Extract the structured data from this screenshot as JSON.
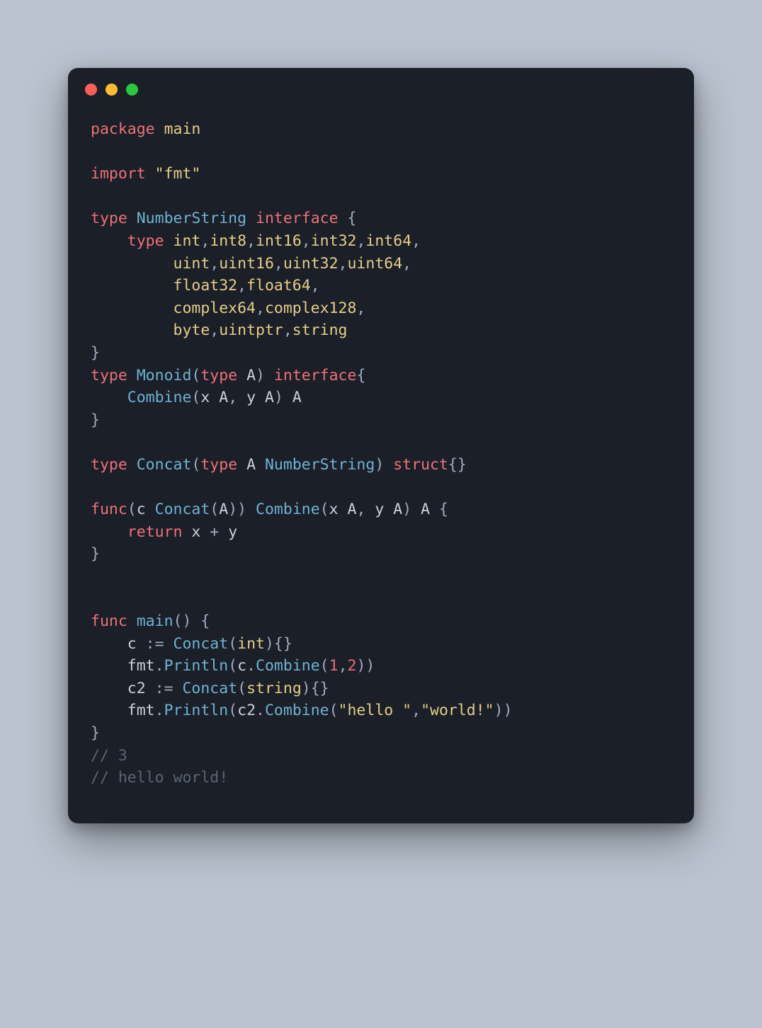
{
  "window": {
    "buttons": [
      "close",
      "minimize",
      "zoom"
    ]
  },
  "code": {
    "tokens": [
      [
        [
          "kw",
          "package"
        ],
        [
          "",
          ""
        ],
        [
          "",
          " "
        ],
        [
          "ident",
          "main"
        ]
      ],
      [],
      [
        [
          "kw",
          "import"
        ],
        [
          "",
          " "
        ],
        [
          "str",
          "\"fmt\""
        ]
      ],
      [],
      [
        [
          "kw",
          "type"
        ],
        [
          "",
          " "
        ],
        [
          "typename",
          "NumberString"
        ],
        [
          "",
          " "
        ],
        [
          "kw",
          "interface"
        ],
        [
          "",
          " "
        ],
        [
          "punct",
          "{"
        ]
      ],
      [
        [
          "",
          "    "
        ],
        [
          "kw",
          "type"
        ],
        [
          "",
          " "
        ],
        [
          "ident",
          "int"
        ],
        [
          "punct",
          ","
        ],
        [
          "ident",
          "int8"
        ],
        [
          "punct",
          ","
        ],
        [
          "ident",
          "int16"
        ],
        [
          "punct",
          ","
        ],
        [
          "ident",
          "int32"
        ],
        [
          "punct",
          ","
        ],
        [
          "ident",
          "int64"
        ],
        [
          "punct",
          ","
        ]
      ],
      [
        [
          "",
          "         "
        ],
        [
          "ident",
          "uint"
        ],
        [
          "punct",
          ","
        ],
        [
          "ident",
          "uint16"
        ],
        [
          "punct",
          ","
        ],
        [
          "ident",
          "uint32"
        ],
        [
          "punct",
          ","
        ],
        [
          "ident",
          "uint64"
        ],
        [
          "punct",
          ","
        ]
      ],
      [
        [
          "",
          "         "
        ],
        [
          "ident",
          "float32"
        ],
        [
          "punct",
          ","
        ],
        [
          "ident",
          "float64"
        ],
        [
          "punct",
          ","
        ]
      ],
      [
        [
          "",
          "         "
        ],
        [
          "ident",
          "complex64"
        ],
        [
          "punct",
          ","
        ],
        [
          "ident",
          "complex128"
        ],
        [
          "punct",
          ","
        ]
      ],
      [
        [
          "",
          "         "
        ],
        [
          "ident",
          "byte"
        ],
        [
          "punct",
          ","
        ],
        [
          "ident",
          "uintptr"
        ],
        [
          "punct",
          ","
        ],
        [
          "ident",
          "string"
        ]
      ],
      [
        [
          "punct",
          "}"
        ]
      ],
      [
        [
          "kw",
          "type"
        ],
        [
          "",
          " "
        ],
        [
          "typename",
          "Monoid"
        ],
        [
          "punct",
          "("
        ],
        [
          "kw",
          "type"
        ],
        [
          "",
          " "
        ],
        [
          "var",
          "A"
        ],
        [
          "punct",
          ")"
        ],
        [
          "",
          " "
        ],
        [
          "kw",
          "interface"
        ],
        [
          "punct",
          "{"
        ]
      ],
      [
        [
          "",
          "    "
        ],
        [
          "typename",
          "Combine"
        ],
        [
          "punct",
          "("
        ],
        [
          "var",
          "x A"
        ],
        [
          "punct",
          ","
        ],
        [
          "",
          " "
        ],
        [
          "var",
          "y A"
        ],
        [
          "punct",
          ")"
        ],
        [
          "",
          " "
        ],
        [
          "var",
          "A"
        ]
      ],
      [
        [
          "punct",
          "}"
        ]
      ],
      [],
      [
        [
          "kw",
          "type"
        ],
        [
          "",
          " "
        ],
        [
          "typename",
          "Concat"
        ],
        [
          "punct",
          "("
        ],
        [
          "kw",
          "type"
        ],
        [
          "",
          " "
        ],
        [
          "var",
          "A "
        ],
        [
          "typename",
          "NumberString"
        ],
        [
          "punct",
          ")"
        ],
        [
          "",
          " "
        ],
        [
          "kw",
          "struct"
        ],
        [
          "punct",
          "{}"
        ]
      ],
      [],
      [
        [
          "kw",
          "func"
        ],
        [
          "punct",
          "("
        ],
        [
          "var",
          "c "
        ],
        [
          "typename",
          "Concat"
        ],
        [
          "punct",
          "("
        ],
        [
          "var",
          "A"
        ],
        [
          "punct",
          "))"
        ],
        [
          "",
          " "
        ],
        [
          "typename",
          "Combine"
        ],
        [
          "punct",
          "("
        ],
        [
          "var",
          "x A"
        ],
        [
          "punct",
          ","
        ],
        [
          "",
          " "
        ],
        [
          "var",
          "y A"
        ],
        [
          "punct",
          ")"
        ],
        [
          "",
          " "
        ],
        [
          "var",
          "A"
        ],
        [
          "",
          " "
        ],
        [
          "punct",
          "{"
        ]
      ],
      [
        [
          "",
          "    "
        ],
        [
          "kw",
          "return"
        ],
        [
          "",
          " "
        ],
        [
          "var",
          "x "
        ],
        [
          "punct",
          "+"
        ],
        [
          "",
          " "
        ],
        [
          "var",
          "y"
        ]
      ],
      [
        [
          "punct",
          "}"
        ]
      ],
      [],
      [],
      [
        [
          "kw",
          "func"
        ],
        [
          "",
          " "
        ],
        [
          "typename",
          "main"
        ],
        [
          "punct",
          "()"
        ],
        [
          "",
          " "
        ],
        [
          "punct",
          "{"
        ]
      ],
      [
        [
          "",
          "    "
        ],
        [
          "var",
          "c "
        ],
        [
          "punct",
          ":="
        ],
        [
          "",
          " "
        ],
        [
          "typename",
          "Concat"
        ],
        [
          "punct",
          "("
        ],
        [
          "ident",
          "int"
        ],
        [
          "punct",
          "){}"
        ]
      ],
      [
        [
          "",
          "    "
        ],
        [
          "var",
          "fmt"
        ],
        [
          "dot",
          "."
        ],
        [
          "typename",
          "Println"
        ],
        [
          "punct",
          "("
        ],
        [
          "var",
          "c"
        ],
        [
          "dot",
          "."
        ],
        [
          "typename",
          "Combine"
        ],
        [
          "punct",
          "("
        ],
        [
          "num",
          "1"
        ],
        [
          "punct",
          ","
        ],
        [
          "num",
          "2"
        ],
        [
          "punct",
          "))"
        ]
      ],
      [
        [
          "",
          "    "
        ],
        [
          "var",
          "c2 "
        ],
        [
          "punct",
          ":="
        ],
        [
          "",
          " "
        ],
        [
          "typename",
          "Concat"
        ],
        [
          "punct",
          "("
        ],
        [
          "ident",
          "string"
        ],
        [
          "punct",
          "){}"
        ]
      ],
      [
        [
          "",
          "    "
        ],
        [
          "var",
          "fmt"
        ],
        [
          "dot",
          "."
        ],
        [
          "typename",
          "Println"
        ],
        [
          "punct",
          "("
        ],
        [
          "var",
          "c2"
        ],
        [
          "dot",
          "."
        ],
        [
          "typename",
          "Combine"
        ],
        [
          "punct",
          "("
        ],
        [
          "str",
          "\"hello \""
        ],
        [
          "punct",
          ","
        ],
        [
          "str",
          "\"world!\""
        ],
        [
          "punct",
          "))"
        ]
      ],
      [
        [
          "punct",
          "}"
        ]
      ],
      [
        [
          "comment",
          "// 3"
        ]
      ],
      [
        [
          "comment",
          "// hello world!"
        ]
      ]
    ]
  }
}
